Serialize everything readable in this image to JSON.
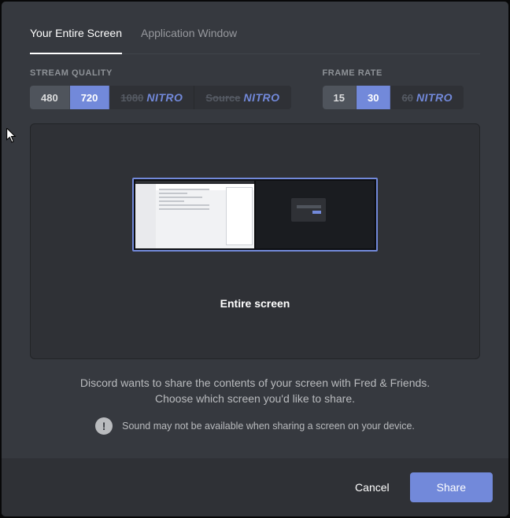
{
  "tabs": {
    "entire_screen": "Your Entire Screen",
    "app_window": "Application Window"
  },
  "quality": {
    "label": "STREAM QUALITY",
    "opt480": "480",
    "opt720": "720",
    "opt1080": "1080",
    "optSource": "Source",
    "nitro": "NITRO"
  },
  "frame": {
    "label": "FRAME RATE",
    "opt15": "15",
    "opt30": "30",
    "opt60": "60",
    "nitro": "NITRO"
  },
  "preview": {
    "label": "Entire screen"
  },
  "info": {
    "line1": "Discord wants to share the contents of your screen with Fred & Friends.",
    "line2": "Choose which screen you'd like to share.",
    "warning": "Sound may not be available when sharing a screen on your device."
  },
  "footer": {
    "cancel": "Cancel",
    "share": "Share"
  }
}
